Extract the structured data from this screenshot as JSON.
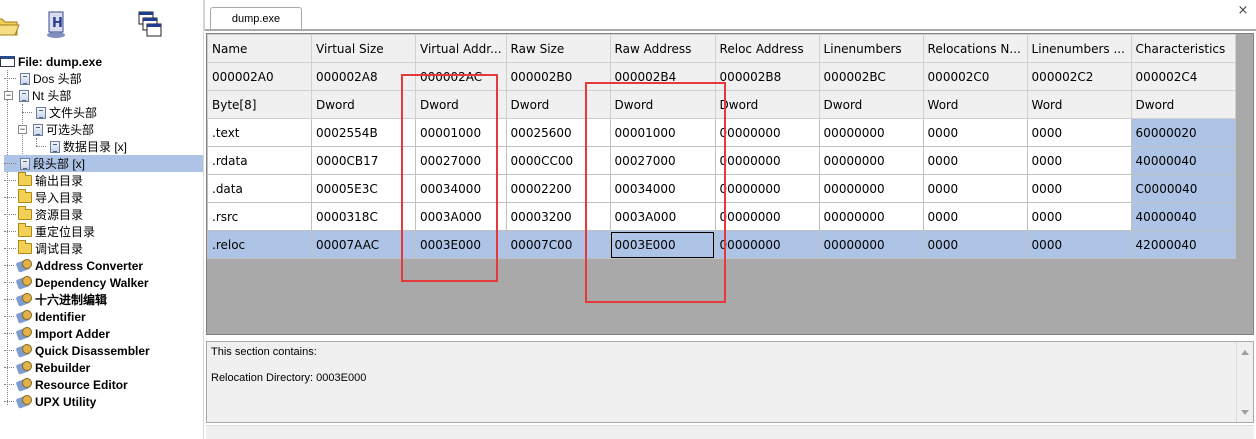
{
  "tab": {
    "title": "dump.exe",
    "close_glyph": "×"
  },
  "tree": {
    "root": "File: dump.exe",
    "items": [
      {
        "label": "Dos 头部",
        "icon": "document-icon"
      },
      {
        "label": "Nt 头部",
        "icon": "document-icon"
      },
      {
        "label": "文件头部",
        "icon": "document-icon"
      },
      {
        "label": "可选头部",
        "icon": "document-icon"
      },
      {
        "label": "数据目录 [x]",
        "icon": "document-icon"
      },
      {
        "label": "段头部 [x]",
        "icon": "document-icon"
      },
      {
        "label": "输出目录",
        "icon": "folder-icon"
      },
      {
        "label": "导入目录",
        "icon": "folder-icon"
      },
      {
        "label": "资源目录",
        "icon": "folder-icon"
      },
      {
        "label": "重定位目录",
        "icon": "folder-icon"
      },
      {
        "label": "调试目录",
        "icon": "folder-icon"
      },
      {
        "label": "Address Converter",
        "icon": "plugin-icon"
      },
      {
        "label": "Dependency Walker",
        "icon": "plugin-icon"
      },
      {
        "label": "十六进制编辑",
        "icon": "plugin-icon"
      },
      {
        "label": "Identifier",
        "icon": "plugin-icon"
      },
      {
        "label": "Import Adder",
        "icon": "plugin-icon"
      },
      {
        "label": "Quick Disassembler",
        "icon": "plugin-icon"
      },
      {
        "label": "Rebuilder",
        "icon": "plugin-icon"
      },
      {
        "label": "Resource Editor",
        "icon": "plugin-icon"
      },
      {
        "label": "UPX Utility",
        "icon": "plugin-icon"
      }
    ]
  },
  "grid": {
    "columns": [
      "Name",
      "Virtual Size",
      "Virtual Addr...",
      "Raw Size",
      "Raw Address",
      "Reloc Address",
      "Linenumbers",
      "Relocations N...",
      "Linenumbers ...",
      "Characteristics"
    ],
    "offsets": [
      "000002A0",
      "000002A8",
      "000002AC",
      "000002B0",
      "000002B4",
      "000002B8",
      "000002BC",
      "000002C0",
      "000002C2",
      "000002C4"
    ],
    "types": [
      "Byte[8]",
      "Dword",
      "Dword",
      "Dword",
      "Dword",
      "Dword",
      "Dword",
      "Word",
      "Word",
      "Dword"
    ],
    "rows": [
      [
        ".text",
        "0002554B",
        "00001000",
        "00025600",
        "00001000",
        "00000000",
        "00000000",
        "0000",
        "0000",
        "60000020"
      ],
      [
        ".rdata",
        "0000CB17",
        "00027000",
        "0000CC00",
        "00027000",
        "00000000",
        "00000000",
        "0000",
        "0000",
        "40000040"
      ],
      [
        ".data",
        "00005E3C",
        "00034000",
        "00002200",
        "00034000",
        "00000000",
        "00000000",
        "0000",
        "0000",
        "C0000040"
      ],
      [
        ".rsrc",
        "0000318C",
        "0003A000",
        "00003200",
        "0003A000",
        "00000000",
        "00000000",
        "0000",
        "0000",
        "40000040"
      ],
      [
        ".reloc",
        "00007AAC",
        "0003E000",
        "00007C00",
        "0003E000",
        "00000000",
        "00000000",
        "0000",
        "0000",
        "42000040"
      ]
    ]
  },
  "info": {
    "line1": "This section contains:",
    "line2": "Relocation Directory: 0003E000"
  },
  "colors": {
    "selection": "#aec4e6",
    "highlight_box": "#e5393b",
    "grid_background": "#a9a9a9"
  }
}
